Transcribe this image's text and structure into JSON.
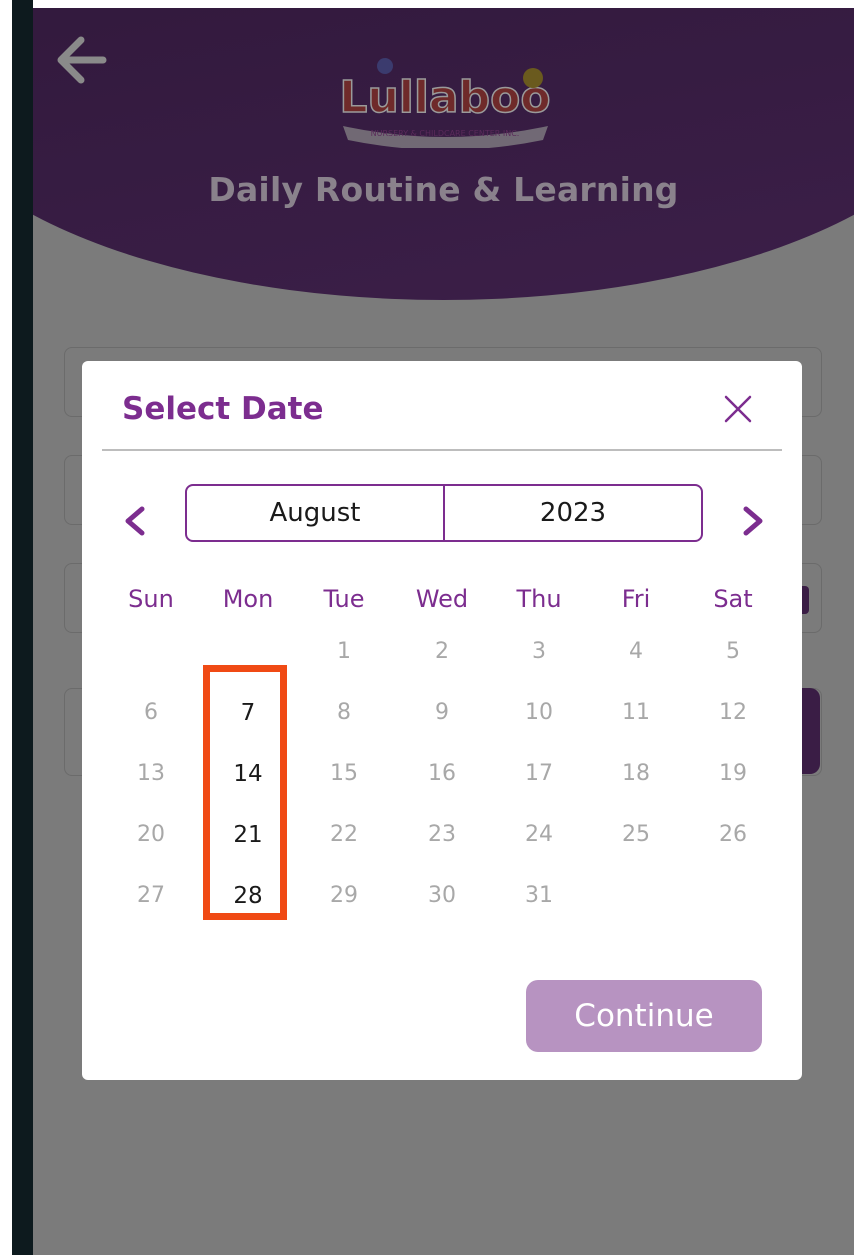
{
  "page": {
    "title": "Daily Routine & Learning"
  },
  "logo": {
    "text": "Lullaboo",
    "tagline": "NURSERY & CHILDCARE CENTER INC."
  },
  "modal": {
    "title": "Select Date",
    "close_icon": "close-icon",
    "prev_icon": "chevron-left-icon",
    "next_icon": "chevron-right-icon",
    "month": "August",
    "year": "2023",
    "weekdays": [
      "Sun",
      "Mon",
      "Tue",
      "Wed",
      "Thu",
      "Fri",
      "Sat"
    ],
    "weeks": [
      [
        "",
        "",
        "1",
        "2",
        "3",
        "4",
        "5"
      ],
      [
        "6",
        "7",
        "8",
        "9",
        "10",
        "11",
        "12"
      ],
      [
        "13",
        "14",
        "15",
        "16",
        "17",
        "18",
        "19"
      ],
      [
        "20",
        "21",
        "22",
        "23",
        "24",
        "25",
        "26"
      ],
      [
        "27",
        "28",
        "29",
        "30",
        "31",
        "",
        ""
      ]
    ],
    "enabled_days": [
      "7",
      "14",
      "21",
      "28"
    ],
    "continue_label": "Continue"
  },
  "colors": {
    "accent": "#7c2d8f",
    "header_bg": "#331a3e",
    "continue_bg": "#b793c1",
    "highlight": "#f04a14",
    "overlay": "#7b7b7b"
  }
}
